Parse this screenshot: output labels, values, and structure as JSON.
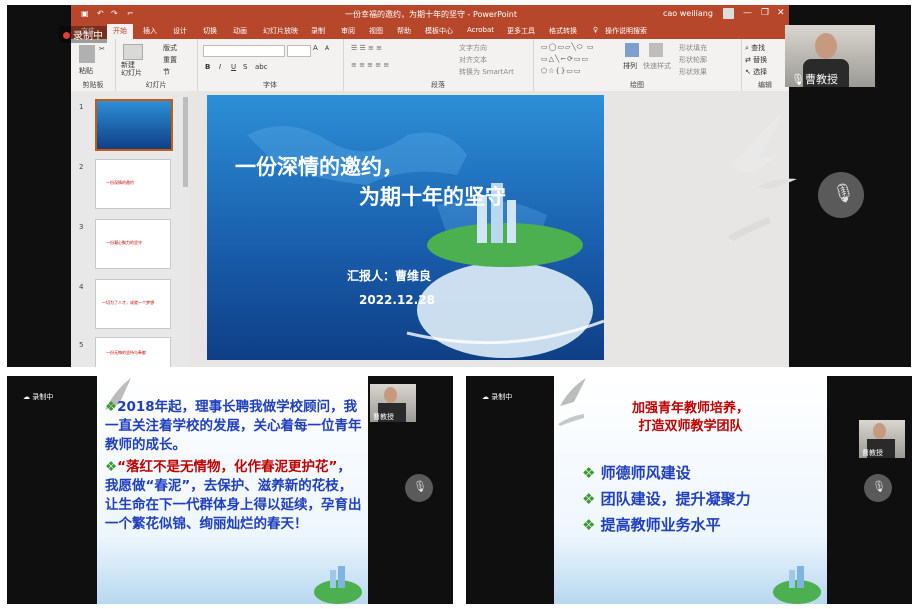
{
  "powerpoint": {
    "window_title": "一份幸福的邀约，为期十年的坚守 - PowerPoint",
    "user": "cao weiliang",
    "tabs": [
      "文件",
      "开始",
      "插入",
      "设计",
      "切换",
      "动画",
      "幻灯片放映",
      "录制",
      "审阅",
      "视图",
      "帮助",
      "模板中心",
      "Acrobat",
      "更多工具",
      "格式转换",
      "操作说明搜索"
    ],
    "selected_tab": "开始",
    "ribbon": {
      "clipboard": {
        "label": "剪贴板",
        "paste": "粘贴",
        "cut": "剪切"
      },
      "slides": {
        "label": "幻灯片",
        "new_slide": "新建\n幻灯片",
        "layout": "版式",
        "reset": "重置",
        "section": "节"
      },
      "font": {
        "label": "字体",
        "bold": "B",
        "italic": "I",
        "underline": "U",
        "strike": "S",
        "shadow": "abc",
        "grow": "A",
        "shrink": "A"
      },
      "paragraph": {
        "label": "段落",
        "text_direction": "文字方向",
        "align_text": "对齐文本",
        "smartart": "转换为 SmartArt"
      },
      "drawing": {
        "label": "绘图",
        "arrange": "排列",
        "quick_styles": "快速样式",
        "fill": "形状填充",
        "outline": "形状轮廓",
        "effects": "形状效果"
      },
      "editing": {
        "label": "编辑",
        "find": "查找",
        "replace": "替换",
        "select": "选择"
      }
    },
    "thumbnails": [
      {
        "num": "1",
        "text": ""
      },
      {
        "num": "2",
        "text": "一份深情的邀约"
      },
      {
        "num": "3",
        "text": "一份凝心聚力的坚守"
      },
      {
        "num": "4",
        "text": "一切为了人才，成就一个梦想"
      },
      {
        "num": "5",
        "text": "一份无悔的坚持与奉献"
      }
    ],
    "slide": {
      "title_line1": "一份深情的邀约，",
      "title_line2": "为期十年的坚守",
      "reporter": "汇报人：曹维良",
      "date": "2022.12.28"
    }
  },
  "meeting": {
    "record_label": "录制中",
    "participant_name": "曹教授"
  },
  "slide2": {
    "para1": "2018年起，理事长聘我做学校顾问，我一直关注着学校的发展，关心着每一位青年教师的成长。",
    "para2_red": "“落红不是无情物，化作春泥更护花”",
    "para2_rest": "，我愿做“春泥”，去保护、滋养新的花枝，让生命在下一代群体身上得以延续，孕育出一个繁花似锦、绚丽灿烂的春天！"
  },
  "slide3": {
    "heading_line1": "加强青年教师培养，",
    "heading_line2": "打造双师教学团队",
    "bullets": [
      "师德师风建设",
      "团队建设，提升凝聚力",
      "提高教师业务水平"
    ]
  },
  "colors": {
    "ppt_red": "#b7472a",
    "heading_red": "#c00000",
    "bullet_blue": "#1f3fbf",
    "bullet_green": "#3a9a2e"
  }
}
